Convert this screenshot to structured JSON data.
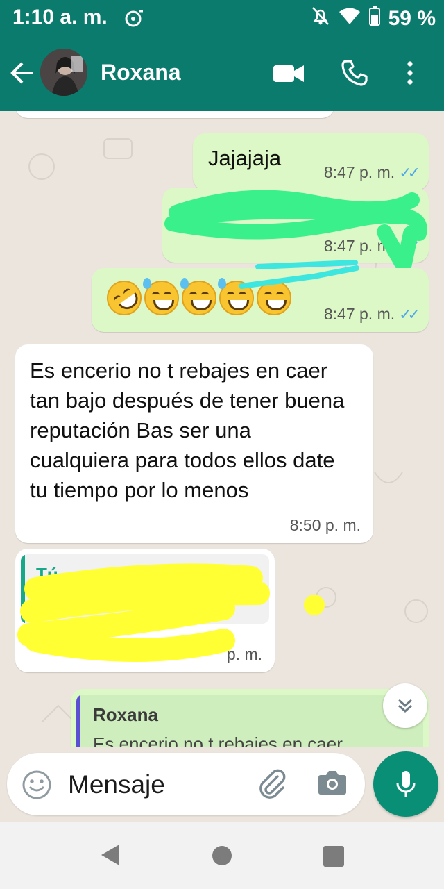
{
  "status_bar": {
    "time": "1:10 a. m.",
    "battery": "59 %"
  },
  "header": {
    "contact_name": "Roxana"
  },
  "colors": {
    "header": "#0a7b6c",
    "outgoing_bubble": "#dcf8c6",
    "incoming_bubble": "#ffffff",
    "read_ticks": "#4fa8e8",
    "mic_button": "#0a8f77",
    "highlight_green": "#39f08a",
    "highlight_cyan": "#3ee6e0",
    "highlight_yellow": "#ffff33"
  },
  "messages": [
    {
      "direction": "out",
      "text": "Jajajaja",
      "time": "8:47 p. m.",
      "status": "read"
    },
    {
      "direction": "out",
      "text": "",
      "time": "8:47 p. m.",
      "status": "read",
      "redacted": true
    },
    {
      "direction": "out",
      "emojis": [
        "rofl-emoji",
        "sweat-smile-emoji",
        "sweat-smile-emoji",
        "sweat-smile-emoji",
        "sweat-smile-emoji"
      ],
      "time": "8:47 p. m.",
      "status": "read"
    },
    {
      "direction": "in",
      "text": "Es encerio no t rebajes en caer tan bajo después de tener buena reputación Bas ser una cualquiera para todos ellos date tu tiempo por lo menos",
      "time": "8:50 p. m."
    },
    {
      "direction": "in",
      "reply_to": "Tú",
      "time": "p. m.",
      "redacted": true
    },
    {
      "direction": "out",
      "reply_to": "Roxana",
      "reply_text": "Es encerio no t rebajes en caer"
    }
  ],
  "composer": {
    "placeholder": "Mensaje"
  }
}
